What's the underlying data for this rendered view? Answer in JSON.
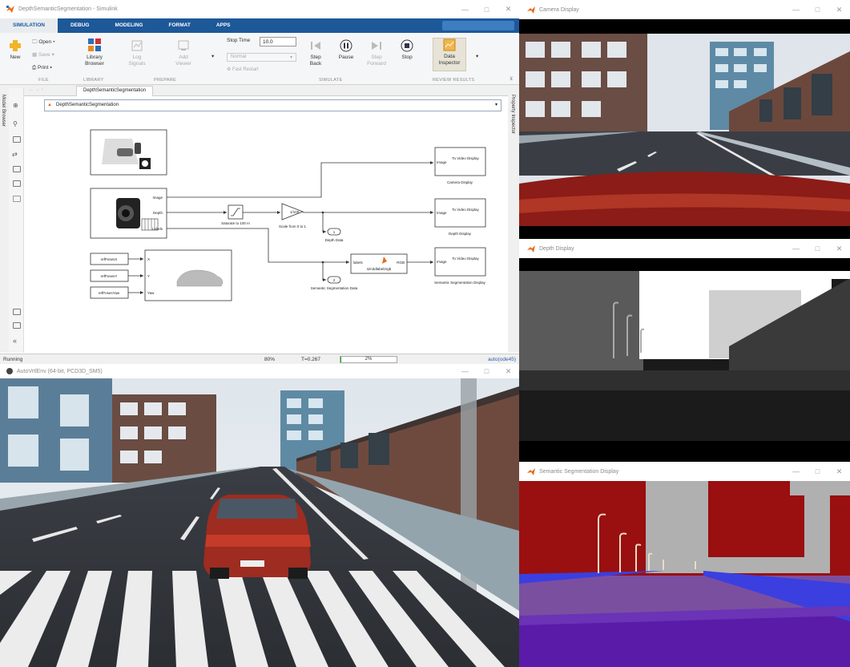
{
  "simulink": {
    "title": "DepthSemanticSegmentation - Simulink",
    "tabs": [
      "SIMULATION",
      "DEBUG",
      "MODELING",
      "FORMAT",
      "APPS"
    ],
    "ribbon": {
      "new": "New",
      "open": "Open",
      "save": "Save",
      "print": "Print",
      "library_browser": "Library Browser",
      "log_signals": "Log Signals",
      "add_viewer": "Add Viewer",
      "stop_time_label": "Stop Time",
      "stop_time_value": "10.0",
      "mode": "Normal",
      "fast_restart": "Fast Restart",
      "step_back": "Step Back",
      "pause": "Pause",
      "step_forward": "Step Forward",
      "stop": "Stop",
      "data_inspector": "Data Inspector",
      "groups": [
        "FILE",
        "LIBRARY",
        "PREPARE",
        "SIMULATE",
        "REVIEW RESULTS"
      ]
    },
    "doc_tab": "DepthSemanticSegmentation",
    "address": "DepthSemanticSegmentation",
    "side_left": "Model Browser",
    "side_right": "Property Inspector",
    "diagram": {
      "camera_ports": [
        "Image",
        "Depth",
        "Labels"
      ],
      "saturate": "Saturate to 100 m",
      "gain_text": "1/100",
      "scale": "Scale from 0 to 1",
      "depth_out_num": "1",
      "depth_out_label": "Depth Data",
      "seg_out_num": "2",
      "seg_out_label": "Semantic Segmentation Data",
      "func_block": "sim3dlabel2rgb",
      "func_in": "labels",
      "func_out": "RGB",
      "to_video": "To Video Display",
      "image_port": "Image",
      "camera_display": "Camera Display",
      "depth_display": "Depth Display",
      "seg_display": "Semantic Segmentation Display",
      "refs": [
        "refPosesX",
        "refPosesY",
        "refPosesYaw"
      ],
      "vehicle_ports": [
        "X",
        "Y",
        "Yaw"
      ]
    },
    "status": {
      "state": "Running",
      "zoom": "80%",
      "time": "T=0.267",
      "progress_label": "2%",
      "progress": 0.02,
      "solver": "auto(ode45)"
    }
  },
  "game": {
    "title": "AutoVrtlEnv (64-bit, PCD3D_SM5)"
  },
  "displays": [
    {
      "title": "Camera Display"
    },
    {
      "title": "Depth Display"
    },
    {
      "title": "Semantic Segmentation Display"
    }
  ],
  "colors": {
    "matlab_blue": "#1d5899",
    "seg_building": "#9a0f0f",
    "seg_sky": "#b0b0b0",
    "seg_road": "#7b4fa0",
    "seg_sidewalk": "#3b3fe0",
    "seg_ground": "#5a1ba8"
  }
}
